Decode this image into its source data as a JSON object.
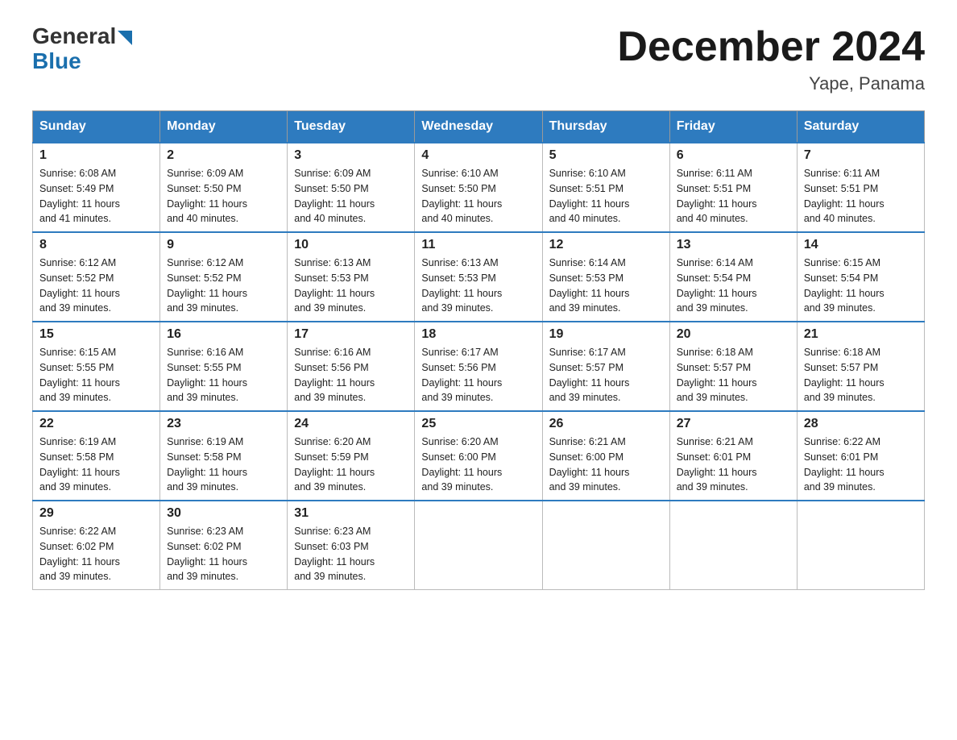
{
  "logo": {
    "general": "General",
    "blue": "Blue"
  },
  "title": "December 2024",
  "location": "Yape, Panama",
  "days_header": [
    "Sunday",
    "Monday",
    "Tuesday",
    "Wednesday",
    "Thursday",
    "Friday",
    "Saturday"
  ],
  "weeks": [
    [
      {
        "day": "1",
        "sunrise": "6:08 AM",
        "sunset": "5:49 PM",
        "daylight": "11 hours and 41 minutes."
      },
      {
        "day": "2",
        "sunrise": "6:09 AM",
        "sunset": "5:50 PM",
        "daylight": "11 hours and 40 minutes."
      },
      {
        "day": "3",
        "sunrise": "6:09 AM",
        "sunset": "5:50 PM",
        "daylight": "11 hours and 40 minutes."
      },
      {
        "day": "4",
        "sunrise": "6:10 AM",
        "sunset": "5:50 PM",
        "daylight": "11 hours and 40 minutes."
      },
      {
        "day": "5",
        "sunrise": "6:10 AM",
        "sunset": "5:51 PM",
        "daylight": "11 hours and 40 minutes."
      },
      {
        "day": "6",
        "sunrise": "6:11 AM",
        "sunset": "5:51 PM",
        "daylight": "11 hours and 40 minutes."
      },
      {
        "day": "7",
        "sunrise": "6:11 AM",
        "sunset": "5:51 PM",
        "daylight": "11 hours and 40 minutes."
      }
    ],
    [
      {
        "day": "8",
        "sunrise": "6:12 AM",
        "sunset": "5:52 PM",
        "daylight": "11 hours and 39 minutes."
      },
      {
        "day": "9",
        "sunrise": "6:12 AM",
        "sunset": "5:52 PM",
        "daylight": "11 hours and 39 minutes."
      },
      {
        "day": "10",
        "sunrise": "6:13 AM",
        "sunset": "5:53 PM",
        "daylight": "11 hours and 39 minutes."
      },
      {
        "day": "11",
        "sunrise": "6:13 AM",
        "sunset": "5:53 PM",
        "daylight": "11 hours and 39 minutes."
      },
      {
        "day": "12",
        "sunrise": "6:14 AM",
        "sunset": "5:53 PM",
        "daylight": "11 hours and 39 minutes."
      },
      {
        "day": "13",
        "sunrise": "6:14 AM",
        "sunset": "5:54 PM",
        "daylight": "11 hours and 39 minutes."
      },
      {
        "day": "14",
        "sunrise": "6:15 AM",
        "sunset": "5:54 PM",
        "daylight": "11 hours and 39 minutes."
      }
    ],
    [
      {
        "day": "15",
        "sunrise": "6:15 AM",
        "sunset": "5:55 PM",
        "daylight": "11 hours and 39 minutes."
      },
      {
        "day": "16",
        "sunrise": "6:16 AM",
        "sunset": "5:55 PM",
        "daylight": "11 hours and 39 minutes."
      },
      {
        "day": "17",
        "sunrise": "6:16 AM",
        "sunset": "5:56 PM",
        "daylight": "11 hours and 39 minutes."
      },
      {
        "day": "18",
        "sunrise": "6:17 AM",
        "sunset": "5:56 PM",
        "daylight": "11 hours and 39 minutes."
      },
      {
        "day": "19",
        "sunrise": "6:17 AM",
        "sunset": "5:57 PM",
        "daylight": "11 hours and 39 minutes."
      },
      {
        "day": "20",
        "sunrise": "6:18 AM",
        "sunset": "5:57 PM",
        "daylight": "11 hours and 39 minutes."
      },
      {
        "day": "21",
        "sunrise": "6:18 AM",
        "sunset": "5:57 PM",
        "daylight": "11 hours and 39 minutes."
      }
    ],
    [
      {
        "day": "22",
        "sunrise": "6:19 AM",
        "sunset": "5:58 PM",
        "daylight": "11 hours and 39 minutes."
      },
      {
        "day": "23",
        "sunrise": "6:19 AM",
        "sunset": "5:58 PM",
        "daylight": "11 hours and 39 minutes."
      },
      {
        "day": "24",
        "sunrise": "6:20 AM",
        "sunset": "5:59 PM",
        "daylight": "11 hours and 39 minutes."
      },
      {
        "day": "25",
        "sunrise": "6:20 AM",
        "sunset": "6:00 PM",
        "daylight": "11 hours and 39 minutes."
      },
      {
        "day": "26",
        "sunrise": "6:21 AM",
        "sunset": "6:00 PM",
        "daylight": "11 hours and 39 minutes."
      },
      {
        "day": "27",
        "sunrise": "6:21 AM",
        "sunset": "6:01 PM",
        "daylight": "11 hours and 39 minutes."
      },
      {
        "day": "28",
        "sunrise": "6:22 AM",
        "sunset": "6:01 PM",
        "daylight": "11 hours and 39 minutes."
      }
    ],
    [
      {
        "day": "29",
        "sunrise": "6:22 AM",
        "sunset": "6:02 PM",
        "daylight": "11 hours and 39 minutes."
      },
      {
        "day": "30",
        "sunrise": "6:23 AM",
        "sunset": "6:02 PM",
        "daylight": "11 hours and 39 minutes."
      },
      {
        "day": "31",
        "sunrise": "6:23 AM",
        "sunset": "6:03 PM",
        "daylight": "11 hours and 39 minutes."
      },
      null,
      null,
      null,
      null
    ]
  ],
  "sunrise_label": "Sunrise:",
  "sunset_label": "Sunset:",
  "daylight_label": "Daylight:"
}
